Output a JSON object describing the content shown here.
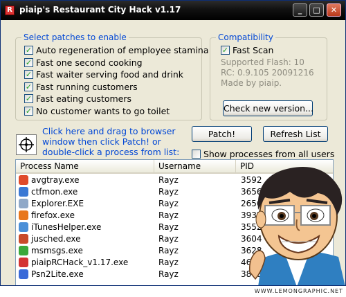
{
  "window": {
    "title": "piaip's Restaurant City Hack v1.17"
  },
  "patches": {
    "group_title": "Select patches to enable",
    "items": [
      {
        "label": "Auto regeneration of employee stamina",
        "checked": true
      },
      {
        "label": "Fast one second cooking",
        "checked": true
      },
      {
        "label": "Fast waiter serving food and drink",
        "checked": true
      },
      {
        "label": "Fast running customers",
        "checked": true
      },
      {
        "label": "Fast eating customers",
        "checked": true
      },
      {
        "label": "No customer wants to go toilet",
        "checked": true
      }
    ]
  },
  "compat": {
    "group_title": "Compatibility",
    "fast_scan_label": "Fast Scan",
    "fast_scan_checked": true,
    "supported_flash": "Supported Flash: 10",
    "rc": "RC: 0.9.105 20091216",
    "made_by": "Made by piaip.",
    "check_button": "Check new version..."
  },
  "target": {
    "line1": "Click here and drag to browser",
    "line2": "window then click Patch! or",
    "line3": "double-click a process from list:"
  },
  "actions": {
    "patch_button": "Patch!",
    "refresh_button": "Refresh List",
    "show_all_label": "Show processes from all users",
    "show_all_checked": false
  },
  "table": {
    "columns": [
      "Process Name",
      "Username",
      "PID"
    ],
    "rows": [
      {
        "name": "avgtray.exe",
        "user": "Rayz",
        "pid": "3592",
        "icon": "avg-icon",
        "color": "#e04a2a"
      },
      {
        "name": "ctfmon.exe",
        "user": "Rayz",
        "pid": "3656",
        "icon": "ctfmon-icon",
        "color": "#3a78d4"
      },
      {
        "name": "Explorer.EXE",
        "user": "Rayz",
        "pid": "2656",
        "icon": "explorer-icon",
        "color": "#8fa8c8"
      },
      {
        "name": "firefox.exe",
        "user": "Rayz",
        "pid": "3932",
        "icon": "firefox-icon",
        "color": "#e8761b"
      },
      {
        "name": "iTunesHelper.exe",
        "user": "Rayz",
        "pid": "3552",
        "icon": "itunes-icon",
        "color": "#4a8fd8"
      },
      {
        "name": "jusched.exe",
        "user": "Rayz",
        "pid": "3604",
        "icon": "java-icon",
        "color": "#c84a2a"
      },
      {
        "name": "msmsgs.exe",
        "user": "Rayz",
        "pid": "3628",
        "icon": "messenger-icon",
        "color": "#3aa83a"
      },
      {
        "name": "piaipRCHack_v1.17.exe",
        "user": "Rayz",
        "pid": "4660",
        "icon": "app-icon",
        "color": "#d33333"
      },
      {
        "name": "Psn2Lite.exe",
        "user": "Rayz",
        "pid": "3808",
        "icon": "psn-icon",
        "color": "#3a6ad8"
      }
    ]
  },
  "watermark": "WWW.LEMONGRAPHIC.NET"
}
